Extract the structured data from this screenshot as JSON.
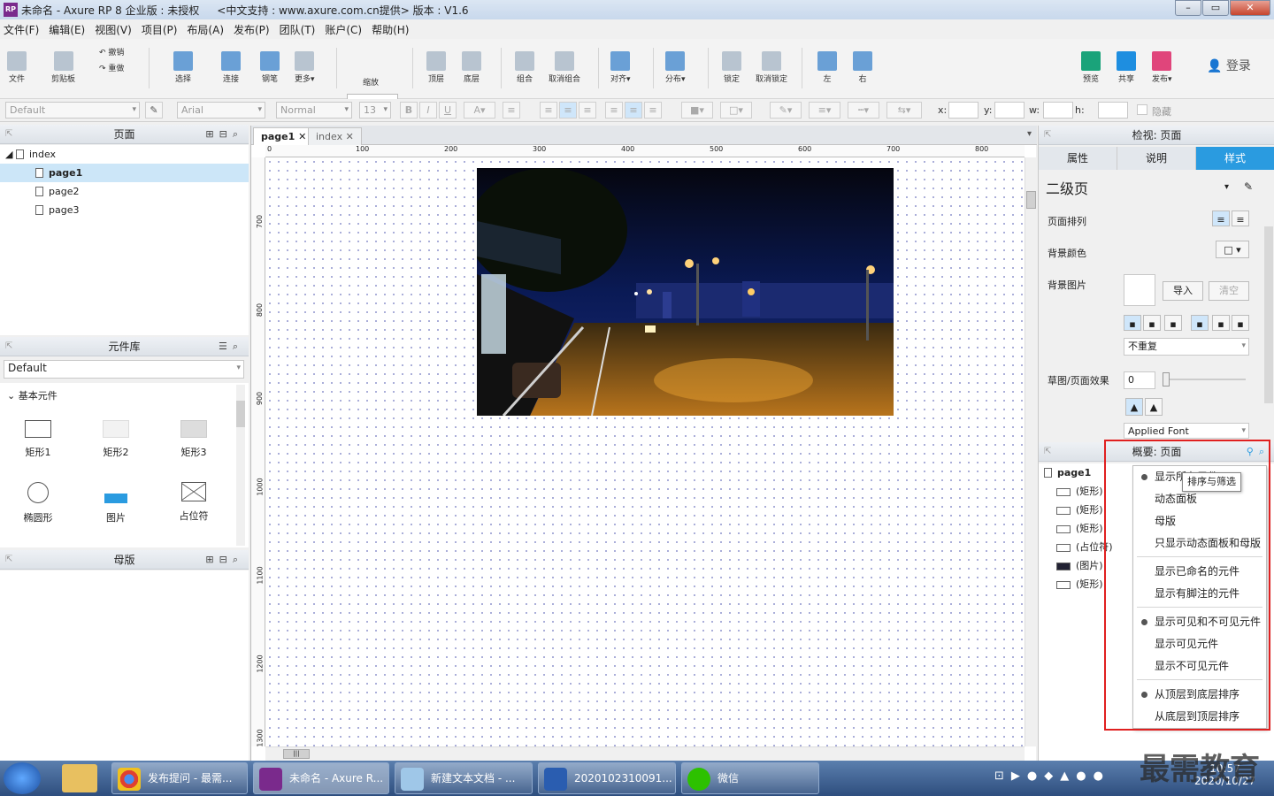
{
  "window": {
    "title": "未命名 - Axure RP 8 企业版 : 未授权",
    "subtitle": "<中文支持 : www.axure.com.cn提供> 版本 : V1.6",
    "logo": "RP"
  },
  "menu": [
    "文件(F)",
    "编辑(E)",
    "视图(V)",
    "项目(P)",
    "布局(A)",
    "发布(P)",
    "团队(T)",
    "账户(C)",
    "帮助(H)"
  ],
  "toolbar": {
    "file": "文件",
    "clipboard": "剪贴板",
    "undo": "撤销",
    "redo": "重做",
    "select": "选择",
    "connect": "连接",
    "pen": "钢笔",
    "more": "更多▾",
    "zoom": "100%",
    "zoom_label": "缩放",
    "top": "顶层",
    "bottom": "底层",
    "group": "组合",
    "ungroup": "取消组合",
    "align": "对齐▾",
    "distribute": "分布▾",
    "lock": "锁定",
    "unlock": "取消锁定",
    "left": "左",
    "right": "右",
    "preview": "预览",
    "share": "共享",
    "publish": "发布▾",
    "login": "登录"
  },
  "format": {
    "style": "Default",
    "font": "Arial",
    "weight": "Normal",
    "size": "13",
    "x": "x:",
    "y": "y:",
    "w": "w:",
    "h": "h:",
    "hidden": "隐藏"
  },
  "pages_panel": {
    "title": "页面",
    "root": "index",
    "pages": [
      "page1",
      "page2",
      "page3"
    ]
  },
  "library_panel": {
    "title": "元件库",
    "library": "Default",
    "section": "基本元件",
    "widgets": [
      "矩形1",
      "矩形2",
      "矩形3",
      "椭圆形",
      "图片",
      "占位符"
    ]
  },
  "masters_panel": {
    "title": "母版"
  },
  "canvas": {
    "tabs": [
      "page1",
      "index"
    ],
    "ruler_h": [
      "0",
      "100",
      "200",
      "300",
      "400",
      "500",
      "600",
      "700",
      "800"
    ],
    "ruler_v": [
      "700",
      "800",
      "900",
      "1000",
      "1100",
      "1200",
      "1300"
    ]
  },
  "inspector": {
    "title": "检视: 页面",
    "tabs": [
      "属性",
      "说明",
      "样式"
    ],
    "style_name": "二级页",
    "page_align": "页面排列",
    "bg_color": "背景颜色",
    "bg_image": "背景图片",
    "import": "导入",
    "clear": "清空",
    "repeat": "不重复",
    "sketch": "草图/页面效果",
    "sketch_value": "0",
    "applied_font": "Applied Font"
  },
  "outline": {
    "title": "概要: 页面",
    "root": "page1",
    "items": [
      "(矩形)",
      "(矩形)",
      "(矩形)",
      "(占位符)",
      "(图片)",
      "(矩形)"
    ],
    "tooltip": "排序与筛选",
    "menu": [
      {
        "label": "显示所有元件",
        "dot": true
      },
      {
        "label": "动态面板",
        "dot": false
      },
      {
        "label": "母版",
        "dot": false
      },
      {
        "label": "只显示动态面板和母版",
        "dot": false,
        "sep": true
      },
      {
        "label": "显示已命名的元件",
        "dot": false
      },
      {
        "label": "显示有脚注的元件",
        "dot": false,
        "sep": true
      },
      {
        "label": "显示可见和不可见元件",
        "dot": true
      },
      {
        "label": "显示可见元件",
        "dot": false
      },
      {
        "label": "显示不可见元件",
        "dot": false,
        "sep": true
      },
      {
        "label": "从顶层到底层排序",
        "dot": true
      },
      {
        "label": "从底层到顶层排序",
        "dot": false
      }
    ]
  },
  "taskbar": {
    "tasks": [
      "发布提问 - 最需...",
      "未命名 - Axure R...",
      "新建文本文档 - ...",
      "2020102310091...",
      "微信"
    ],
    "time": "10:57",
    "date": "2020/10/27",
    "watermark": "最需教育"
  },
  "colors": {
    "accent": "#2a9be0",
    "highlight_box": "#e02020",
    "taskbar": "#2e4e7e"
  }
}
